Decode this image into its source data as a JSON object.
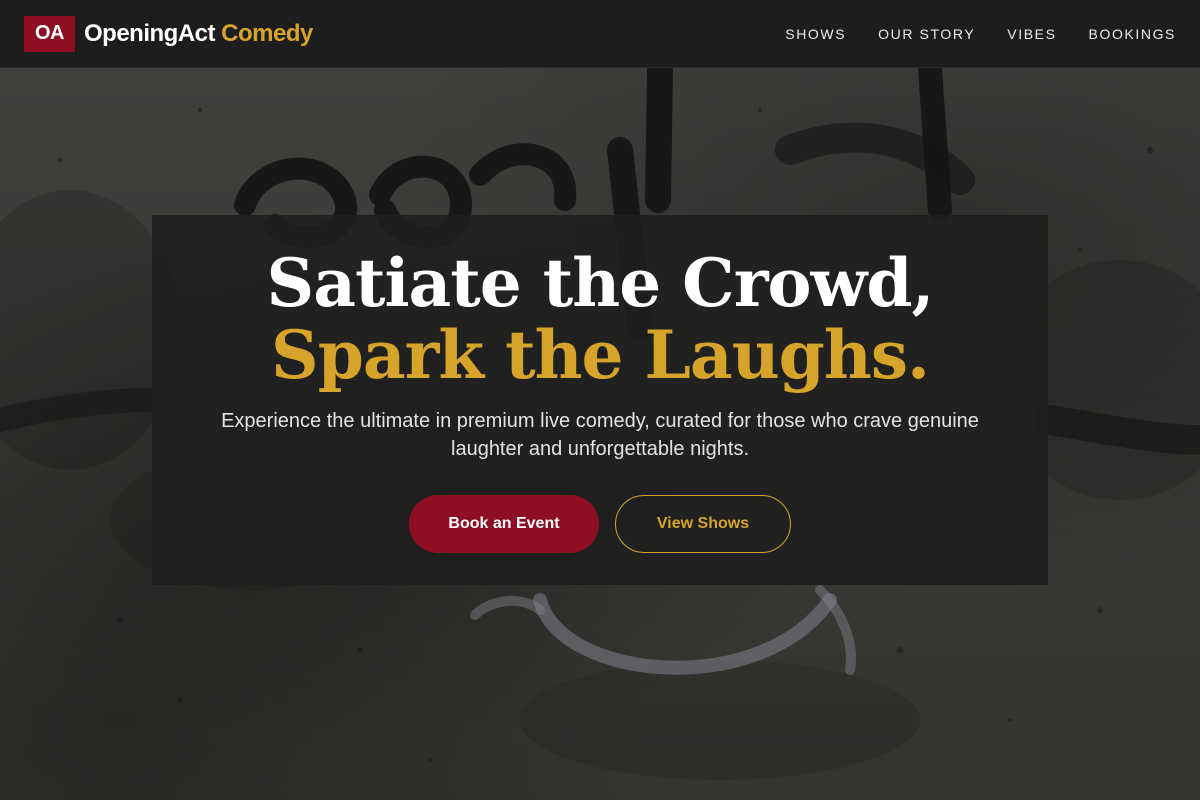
{
  "brand": {
    "logo_text": "OA",
    "name_main": "OpeningAct",
    "name_accent": "Comedy"
  },
  "nav": {
    "items": [
      {
        "label": "SHOWS"
      },
      {
        "label": "OUR STORY"
      },
      {
        "label": "VIBES"
      },
      {
        "label": "BOOKINGS"
      }
    ]
  },
  "hero": {
    "headline_white": "Satiate the Crowd, ",
    "headline_gold": "Spark the Laughs.",
    "subtext": "Experience the ultimate in premium live comedy, curated for those who crave genuine laughter and unforgettable nights.",
    "primary_cta": "Book an Event",
    "secondary_cta": "View Shows",
    "background_image": "concrete-wall-graffiti"
  },
  "colors": {
    "brand_red": "#8e0f24",
    "accent_gold": "#d6a42a",
    "header_bg": "#1d1d1d"
  }
}
